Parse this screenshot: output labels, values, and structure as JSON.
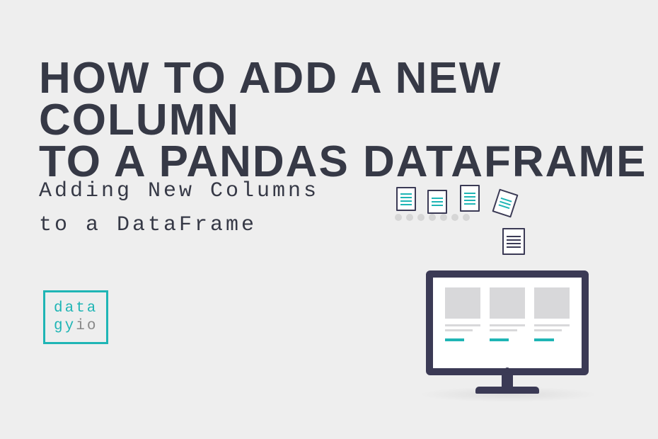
{
  "headline": {
    "line1": "HOW TO ADD A NEW COLUMN",
    "line2": "TO A PANDAS DATAFRAME"
  },
  "subtitle": {
    "line1": "Adding New Columns",
    "line2": "to a DataFrame"
  },
  "logo": {
    "line1": "data",
    "line2_part1": "gy",
    "line2_part2": "io"
  },
  "colors": {
    "accent": "#1fb5b5",
    "dark": "#363946",
    "frame": "#3b3a55",
    "background": "#eeeeee"
  }
}
